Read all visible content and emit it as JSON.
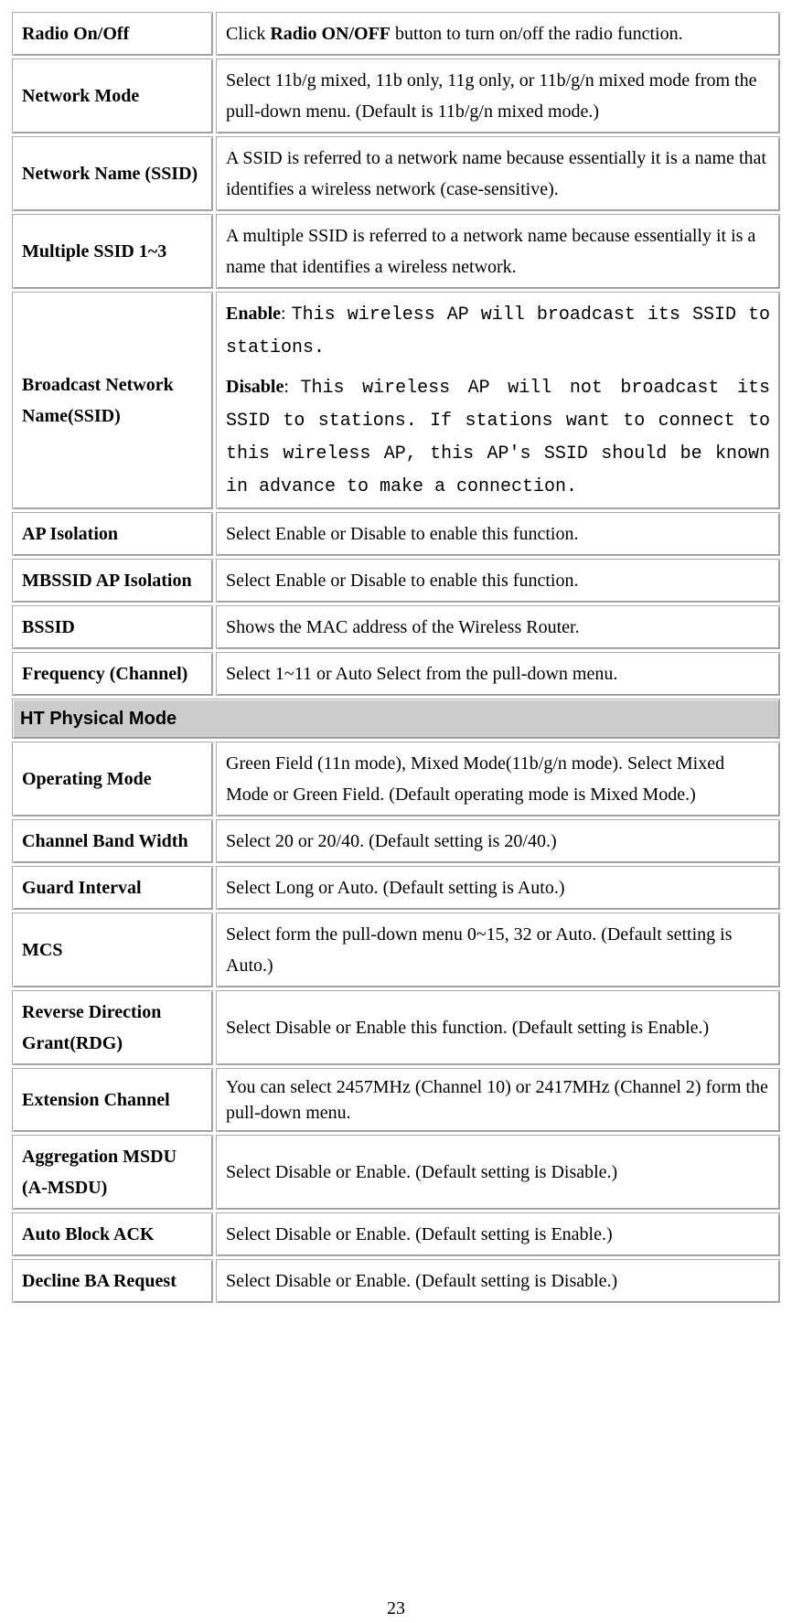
{
  "rows1": [
    {
      "label": "Radio On/Off",
      "desc_pre": "Click ",
      "desc_bold": "Radio ON/OFF",
      "desc_post": " button to turn on/off the radio function."
    },
    {
      "label": "Network Mode",
      "desc": "Select 11b/g mixed, 11b only, 11g only, or 11b/g/n mixed mode from the pull-down menu. (Default is 11b/g/n mixed mode.)"
    },
    {
      "label": "Network Name (SSID)",
      "desc": "A SSID is referred to a network name because essentially it is a name that identifies a wireless network (case-sensitive)."
    },
    {
      "label": "Multiple SSID 1~3",
      "desc": "A multiple SSID is referred to a network name because essentially it is a name that identifies a wireless network."
    }
  ],
  "broadcast": {
    "label": "Broadcast Network Name(SSID)",
    "enable_label": "Enable",
    "enable_text": "This wireless AP will broadcast its SSID to stations.",
    "disable_label": "Disable",
    "disable_text": "This wireless AP will not broadcast its SSID to stations. If stations want to connect to this wireless AP, this AP's SSID should be known in advance to make a connection."
  },
  "rows2": [
    {
      "label": "AP Isolation",
      "desc": "Select Enable or Disable to enable this function."
    },
    {
      "label": "MBSSID AP Isolation",
      "desc": "Select Enable or Disable to enable this function."
    },
    {
      "label": "BSSID",
      "desc": "Shows the MAC address of the Wireless  Router."
    },
    {
      "label": "Frequency (Channel)",
      "desc": "Select 1~11 or Auto Select from the pull-down menu."
    }
  ],
  "section_header": "HT Physical Mode",
  "rows3": [
    {
      "label": "Operating Mode",
      "desc": "Green Field (11n mode), Mixed Mode(11b/g/n mode). Select Mixed Mode or Green Field. (Default operating mode is Mixed Mode.)"
    },
    {
      "label": "Channel Band Width",
      "desc": "Select 20 or 20/40. (Default setting is 20/40.)"
    },
    {
      "label": "Guard Interval",
      "desc": "Select Long or Auto. (Default setting is Auto.)"
    },
    {
      "label": "MCS",
      "desc": "Select form the pull-down menu 0~15, 32 or Auto. (Default setting is Auto.)"
    },
    {
      "label": "Reverse Direction Grant(RDG)",
      "desc": "Select Disable or Enable this function. (Default setting is Enable.)"
    },
    {
      "label": "Extension Channel",
      "desc": "You can select 2457MHz (Channel 10) or 2417MHz (Channel 2) form the pull-down menu."
    },
    {
      "label": "Aggregation MSDU (A-MSDU)",
      "desc": "Select Disable or Enable. (Default setting is Disable.)"
    },
    {
      "label": "Auto Block ACK",
      "desc": "Select Disable or Enable. (Default setting is Enable.)"
    },
    {
      "label": "Decline BA Request",
      "desc": "Select Disable or Enable. (Default setting is Disable.)"
    }
  ],
  "page_number": "23"
}
